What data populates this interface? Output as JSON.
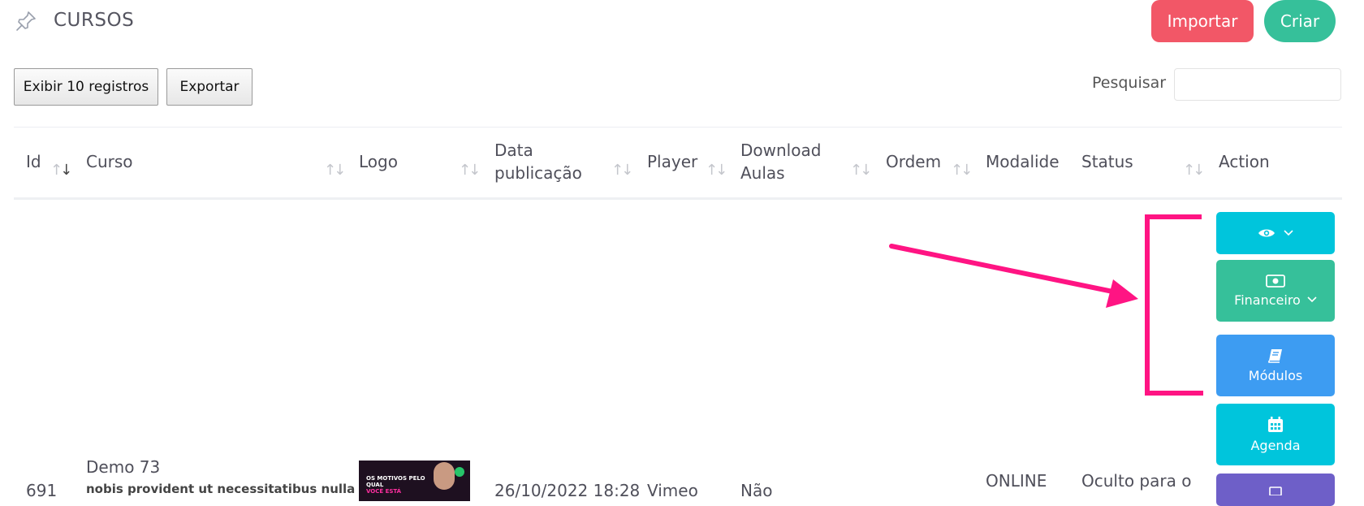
{
  "header": {
    "title": "CURSOS",
    "import_label": "Importar",
    "create_label": "Criar"
  },
  "toolbar": {
    "records_label": "Exibir 10 registros",
    "export_label": "Exportar",
    "search_label": "Pesquisar",
    "search_value": ""
  },
  "table": {
    "columns": {
      "id": "Id",
      "course": "Curso",
      "logo": "Logo",
      "date_line1": "Data",
      "date_line2": "publicação",
      "player": "Player",
      "download_line1": "Download",
      "download_line2": "Aulas",
      "order": "Ordem",
      "modality": "Modalide",
      "status": "Status",
      "action": "Action"
    },
    "row": {
      "id": "691",
      "course_name": "Demo 73",
      "course_desc": "nobis provident ut necessitatibus nulla",
      "logo_text_line1": "OS MOTIVOS PELO",
      "logo_text_line2": "QUAL",
      "logo_text_line3": "VOCÊ ESTÁ",
      "date": "26/10/2022 18:28",
      "player": "Vimeo",
      "download": "Não",
      "modality": "ONLINE",
      "status": "Oculto para o"
    }
  },
  "actions": {
    "financial_label": "Financeiro",
    "modules_label": "Módulos",
    "agenda_label": "Agenda"
  },
  "colors": {
    "import": "#f25767",
    "create": "#36c09a",
    "view": "#00c5dc",
    "financial": "#36c09a",
    "modules": "#3d9cf2",
    "agenda": "#00c5dc",
    "extra": "#6e5fc8",
    "annotation": "#ff1483"
  }
}
